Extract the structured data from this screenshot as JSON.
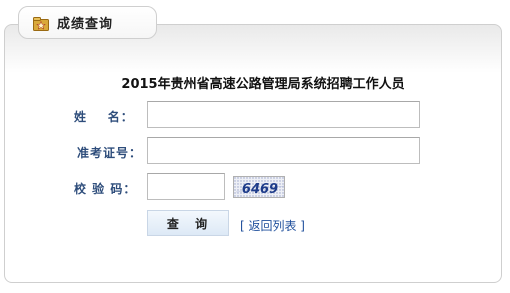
{
  "tab": {
    "title": "成绩查询",
    "icon": "folder-star-icon"
  },
  "form": {
    "heading": "2015年贵州省高速公路管理局系统招聘工作人员",
    "name_label": "姓    名：",
    "exam_id_label": "准考证号：",
    "captcha_label": "校 验 码：",
    "captcha_text": "6469"
  },
  "actions": {
    "submit_label": "查 询",
    "back_link": "[ 返回列表 ]"
  },
  "colors": {
    "label": "#2e4d7b",
    "link": "#1f4f9c",
    "captcha_text": "#1e3c8a",
    "button_top": "#f3f8fd",
    "button_bottom": "#dde9f6"
  }
}
